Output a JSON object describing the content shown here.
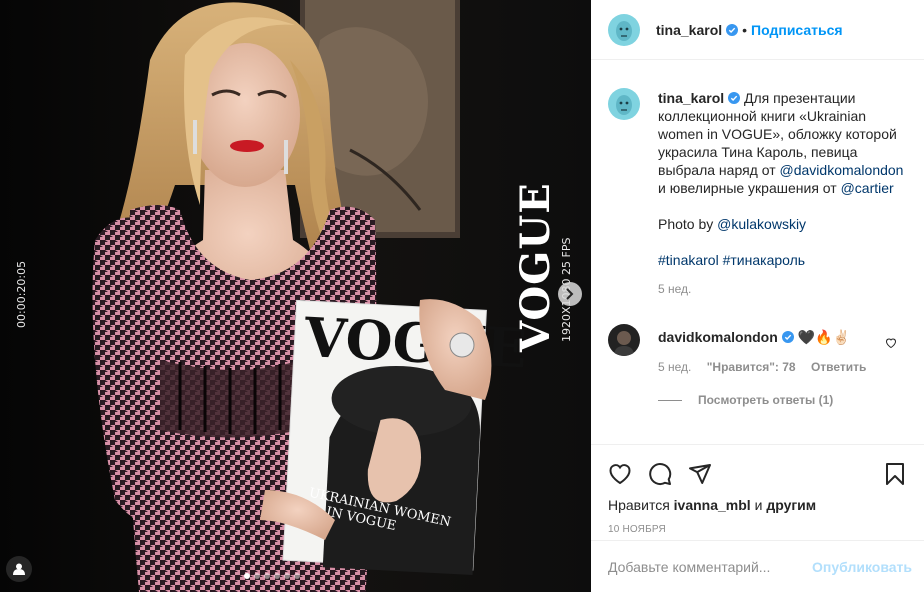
{
  "media": {
    "timecode": "00:00:20:05",
    "resolution_fps": "1920X1080 25 FPS",
    "side_logo": "VOGUE",
    "magazine_logo": "VOGUE",
    "magazine_cover_text": "UKRAINIAN WOMEN IN VOGUE",
    "carousel_dots": 6,
    "carousel_active": 0
  },
  "header": {
    "username": "tina_karol",
    "separator": "•",
    "follow_label": "Подписаться"
  },
  "caption": {
    "username": "tina_karol",
    "text_1": "Для презентации коллекционной книги «Ukrainian women in VOGUE», обложку которой украсила Тина Кароль, певица выбрала наряд от ",
    "mention_1": "@davidkomalondon",
    "text_2": " и ювелирные украшения от ",
    "mention_2": "@cartier",
    "photo_by": "Photo by ",
    "mention_3": "@kulakowskiy",
    "tag_1": "#tinakarol",
    "tag_2": "#тинакароль",
    "time": "5 нед."
  },
  "reply": {
    "username": "davidkomalondon",
    "emoji": "🖤🔥✌🏻",
    "time": "5 нед.",
    "likes": "\"Нравится\": 78",
    "reply_label": "Ответить",
    "view_replies": "Посмотреть ответы (1)"
  },
  "actions": {
    "liked_by_prefix": "Нравится ",
    "liked_by_user": "ivanna_mbl",
    "liked_by_suffix": " и ",
    "liked_by_others": "другим",
    "date": "10 ноября"
  },
  "comment_box": {
    "placeholder": "Добавьте комментарий...",
    "post_label": "Опубликовать"
  },
  "colors": {
    "accent": "#0095f6",
    "verified": "#3897f0",
    "post_disabled": "#b2dffc",
    "muted": "#8e8e8e"
  }
}
